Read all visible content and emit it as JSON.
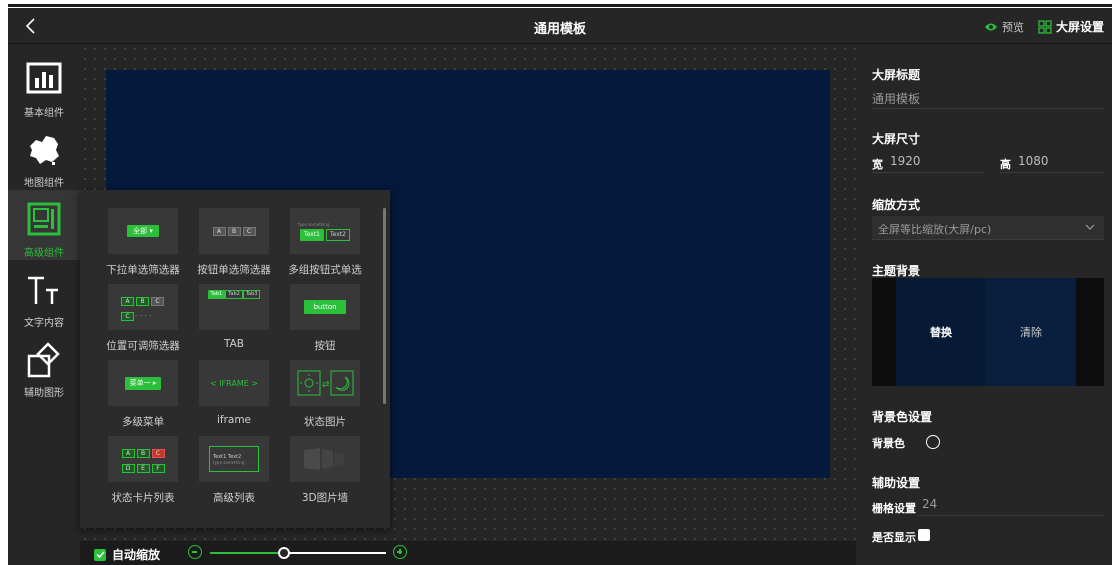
{
  "topbar": {
    "title": "通用模板",
    "preview_label": "预览",
    "settings_label": "大屏设置"
  },
  "leftbar": {
    "items": [
      {
        "label": "基本组件",
        "icon": "bar-chart-icon"
      },
      {
        "label": "地图组件",
        "icon": "china-map-icon"
      },
      {
        "label": "高级组件",
        "icon": "advanced-component-icon",
        "active": true
      },
      {
        "label": "文字内容",
        "icon": "text-icon"
      },
      {
        "label": "辅助图形",
        "icon": "shapes-icon"
      }
    ]
  },
  "popup": {
    "cards": [
      {
        "caption": "下拉单选筛选器",
        "thumb_text": "全部"
      },
      {
        "caption": "按钮单选筛选器",
        "thumb_text": [
          "A",
          "B",
          "C"
        ]
      },
      {
        "caption": "多组按钮式单选",
        "thumb_text": [
          "type something . . .",
          "Text1",
          "Text2"
        ]
      },
      {
        "caption": "位置可调筛选器",
        "thumb_text": [
          "A",
          "B",
          "C",
          "C"
        ]
      },
      {
        "caption": "TAB",
        "thumb_text": [
          "Tab1",
          "Tab2",
          "Tab3"
        ]
      },
      {
        "caption": "按钮",
        "thumb_text": "button"
      },
      {
        "caption": "多级菜单",
        "thumb_text": "菜单一"
      },
      {
        "caption": "iframe",
        "thumb_text": "< IFRAME >"
      },
      {
        "caption": "状态图片",
        "thumb_text": ""
      },
      {
        "caption": "状态卡片列表",
        "thumb_text": [
          "A",
          "B",
          "C",
          "D",
          "E",
          "F"
        ]
      },
      {
        "caption": "高级列表",
        "thumb_text": [
          "Text1",
          "Text2",
          "type something . . ."
        ]
      },
      {
        "caption": "3D图片墙",
        "thumb_text": ""
      }
    ]
  },
  "bottombar": {
    "autozoom_label": "自动缩放",
    "autozoom_checked": true,
    "zoom_fraction": 0.42
  },
  "rightbar": {
    "screen_title_label": "大屏标题",
    "screen_title_value": "通用模板",
    "size_label": "大屏尺寸",
    "width_label": "宽",
    "width_value": "1920",
    "height_label": "高",
    "height_value": "1080",
    "scale_label": "缩放方式",
    "scale_value": "全屏等比缩放(大屏/pc)",
    "theme_bg_label": "主题背景",
    "replace_label": "替换",
    "clear_label": "清除",
    "bg_color_section": "背景色设置",
    "bg_color_label": "背景色",
    "aux_section": "辅助设置",
    "grid_label": "栅格设置",
    "grid_value": "24",
    "show_label": "是否显示"
  },
  "colors": {
    "accent": "#2bbf3a",
    "screen_bg": "#04193b",
    "panel_bg": "#262626"
  }
}
